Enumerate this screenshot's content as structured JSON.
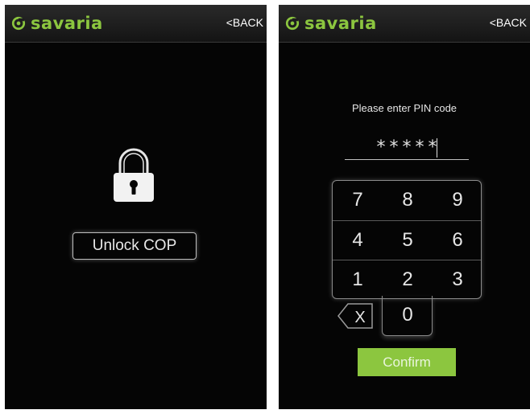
{
  "brand": {
    "name": "savaria",
    "color": "#8cc63f"
  },
  "left_screen": {
    "back_label": "<BACK",
    "lock_icon": "padlock-icon",
    "unlock_button_label": "Unlock COP"
  },
  "right_screen": {
    "back_label": "<BACK",
    "pin_prompt": "Please enter PIN code",
    "pin_mask": "*****",
    "keypad": {
      "rows": [
        [
          "7",
          "8",
          "9"
        ],
        [
          "4",
          "5",
          "6"
        ],
        [
          "1",
          "2",
          "3"
        ]
      ],
      "zero": "0",
      "backspace_icon": "backspace-icon",
      "backspace_label": "X"
    },
    "confirm_label": "Confirm"
  }
}
